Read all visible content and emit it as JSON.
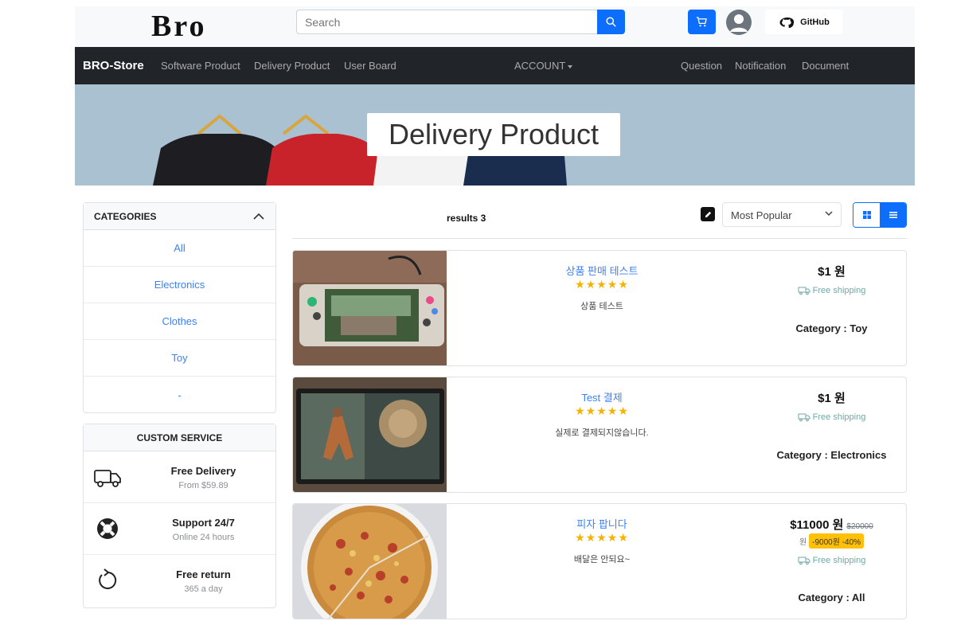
{
  "header": {
    "logo": "Bro",
    "search_placeholder": "Search",
    "github_label": "GitHub"
  },
  "navbar": {
    "brand": "BRO-Store",
    "links": [
      "Software Product",
      "Delivery Product",
      "User Board"
    ],
    "account": "ACCOUNT",
    "right_links": [
      "Question",
      "Notification",
      "Document"
    ]
  },
  "banner": {
    "title": "Delivery Product"
  },
  "categories": {
    "title": "CATEGORIES",
    "items": [
      "All",
      "Electronics",
      "Clothes",
      "Toy",
      "-"
    ]
  },
  "service": {
    "title": "CUSTOM SERVICE",
    "items": [
      {
        "icon": "truck-icon",
        "title": "Free Delivery",
        "sub": "From $59.89"
      },
      {
        "icon": "lifebuoy-icon",
        "title": "Support 24/7",
        "sub": "Online 24 hours"
      },
      {
        "icon": "return-icon",
        "title": "Free return",
        "sub": "365 a day"
      }
    ]
  },
  "toolbar": {
    "results": "results 3",
    "sort_selected": "Most Popular"
  },
  "products": [
    {
      "name": "상품 판매 테스트",
      "stars": "★★★★★",
      "desc": "상품 테스트",
      "price": "$1 원",
      "shipping": "Free shipping",
      "category": "Category : Toy",
      "image": "handheld-console-photo"
    },
    {
      "name": "Test 결제",
      "stars": "★★★★★",
      "desc": "실제로 결제되지않습니다.",
      "price": "$1 원",
      "shipping": "Free shipping",
      "category": "Category : Electronics",
      "image": "tablet-game-photo"
    },
    {
      "name": "피자 팝니다",
      "stars": "★★★★★",
      "desc": "배달은 안되요~",
      "price": "$11000 원",
      "old_price": "$20000",
      "discount_unit": "원",
      "discount_badge": "-9000원 -40%",
      "shipping": "Free shipping",
      "category": "Category : All",
      "image": "pizza-photo"
    }
  ],
  "colors": {
    "primary": "#0d6efd",
    "navbar": "#212529",
    "link": "#3b82f6",
    "star": "#f5b301",
    "badge": "#ffc107"
  }
}
